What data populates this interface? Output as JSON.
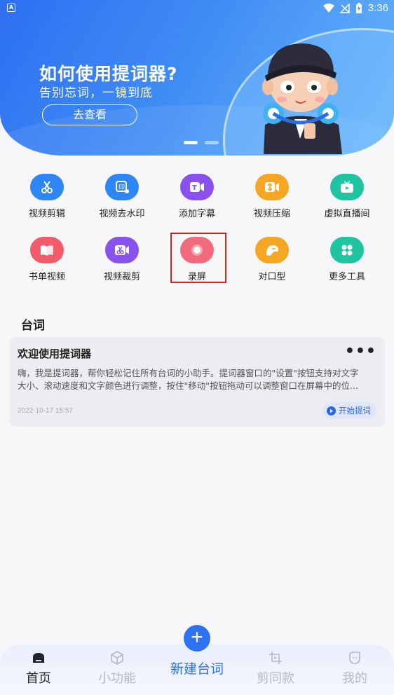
{
  "status_bar": {
    "time": "3:36",
    "app_badge": "A"
  },
  "banner": {
    "title": "如何使用提词器?",
    "subtitle": "告别忘词，一镜到底",
    "button_label": "去查看",
    "slides": 2
  },
  "tools": [
    {
      "label": "视频剪辑",
      "icon": "scissors-icon",
      "color": "#2e86f5"
    },
    {
      "label": "视频去水印",
      "icon": "watermark-icon",
      "color": "#2e86f5"
    },
    {
      "label": "添加字幕",
      "icon": "subtitle-icon",
      "color": "#8a52ec"
    },
    {
      "label": "视频压缩",
      "icon": "compress-icon",
      "color": "#f5a623"
    },
    {
      "label": "虚拟直播间",
      "icon": "live-room-icon",
      "color": "#1fc5a0"
    },
    {
      "label": "书单视频",
      "icon": "book-icon",
      "color": "#f25b6a"
    },
    {
      "label": "视频裁剪",
      "icon": "crop-icon",
      "color": "#8a52ec"
    },
    {
      "label": "录屏",
      "icon": "record-icon",
      "color": "#f26b7c"
    },
    {
      "label": "对口型",
      "icon": "lip-sync-icon",
      "color": "#f5a623"
    },
    {
      "label": "更多工具",
      "icon": "more-tools-icon",
      "color": "#1fc5a0"
    }
  ],
  "scripts_section": {
    "title": "台词",
    "card": {
      "title": "欢迎使用提词器",
      "more": "•••",
      "line1": "嗨，我是提词器，帮你轻松记住所有台词的小助手。提词器窗口的\"设置\"按钮支持对文字",
      "line2": "大小、滚动速度和文字颜色进行调整，按住\"移动\"按钮拖动可以调整窗口在屏幕中的位...",
      "date": "2022-10-17 15:57",
      "start_label": "开始提词"
    }
  },
  "fab": {
    "label": "+"
  },
  "bottom_nav": {
    "center_label": "新建台词",
    "items": [
      {
        "label": "首页",
        "icon": "home-icon",
        "active": true
      },
      {
        "label": "小功能",
        "icon": "cube-icon",
        "active": false
      },
      {
        "label": "剪同款",
        "icon": "template-icon",
        "active": false
      },
      {
        "label": "我的",
        "icon": "profile-icon",
        "active": false
      }
    ]
  },
  "colors": {
    "accent": "#2e72f2",
    "highlight": "#e02020"
  }
}
